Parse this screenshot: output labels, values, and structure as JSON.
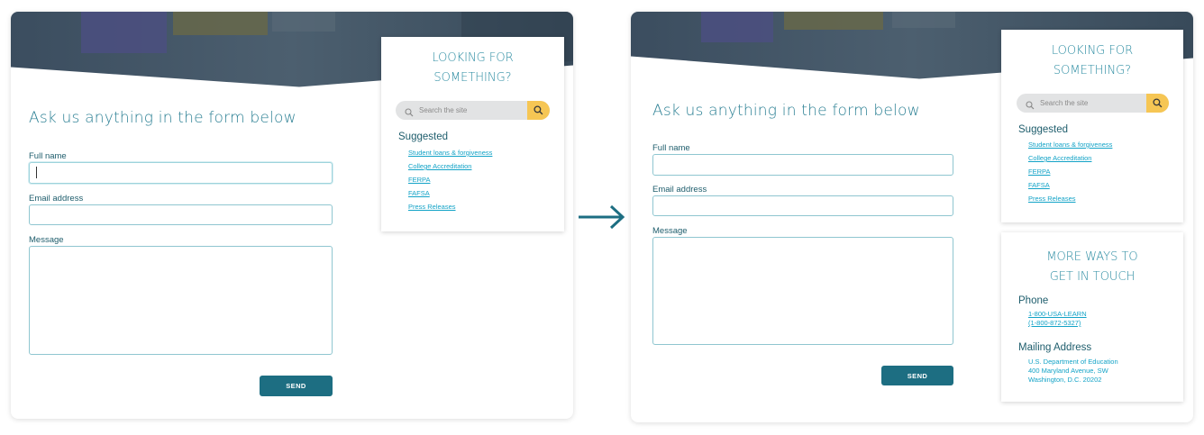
{
  "before": {
    "form_title": "Ask us anything in the form below",
    "fields": {
      "full_name_label": "Full name",
      "email_label": "Email address",
      "message_label": "Message"
    },
    "send_label": "SEND",
    "search_card": {
      "title_line1": "LOOKING FOR",
      "title_line2": "SOMETHING?",
      "search_placeholder": "Search the site",
      "suggested_title": "Suggested",
      "links": [
        "Student loans & forgiveness",
        "College Accreditation",
        "FERPA",
        "FAFSA",
        "Press Releases"
      ]
    }
  },
  "after": {
    "form_title": "Ask us anything in the form below",
    "fields": {
      "full_name_label": "Full name",
      "email_label": "Email address",
      "message_label": "Message"
    },
    "send_label": "SEND",
    "search_card": {
      "title_line1": "LOOKING FOR",
      "title_line2": "SOMETHING?",
      "search_placeholder": "Search the site",
      "suggested_title": "Suggested",
      "links": [
        "Student loans & forgiveness",
        "College Accreditation",
        "FERPA",
        "FAFSA",
        "Press Releases"
      ]
    },
    "contact_card": {
      "title_line1": "MORE WAYS TO",
      "title_line2": "GET IN TOUCH",
      "phone_title": "Phone",
      "phone_line1": "1-800-USA-LEARN",
      "phone_line2": "(1-800-872-5327)",
      "mail_title": "Mailing Address",
      "mail_line1": "U.S. Department of Education",
      "mail_line2": "400 Maryland Avenue, SW",
      "mail_line3": "Washington, D.C. 20202"
    }
  },
  "colors": {
    "accent": "#1d6e82",
    "link": "#13a3c7",
    "search_button": "#f6c654",
    "arrow": "#1d6e82"
  },
  "icons": [
    "search-icon",
    "arrow-right-icon"
  ]
}
